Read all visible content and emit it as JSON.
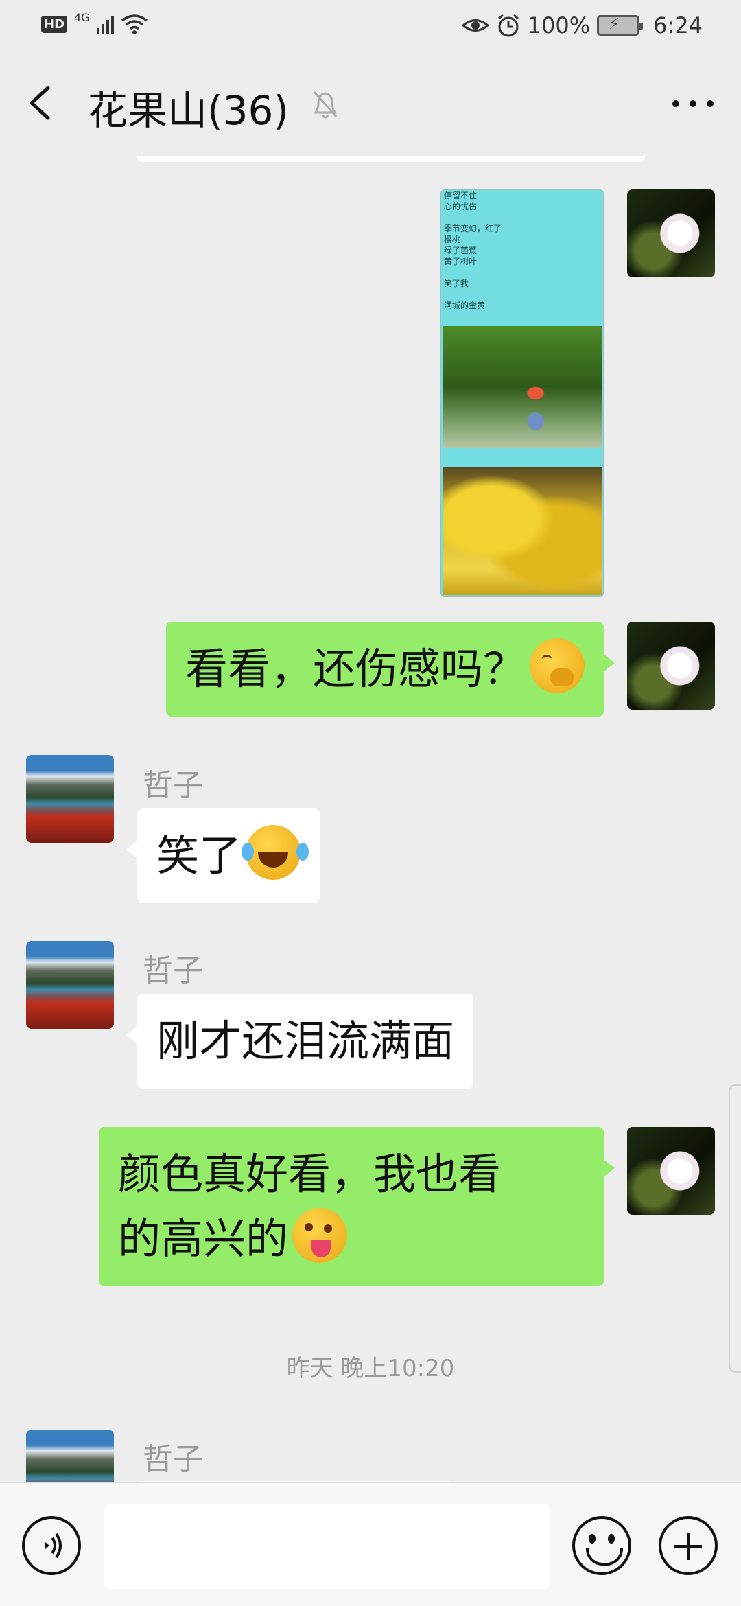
{
  "status_bar": {
    "hd": "HD",
    "network": "4G",
    "battery": "100%",
    "time": "6:24",
    "icons": [
      "hd-badge",
      "signal-icon",
      "wifi-icon",
      "eye-icon",
      "alarm-icon",
      "battery-icon"
    ]
  },
  "header": {
    "title": "花果山(36)",
    "icons": [
      "back-icon",
      "mute-icon",
      "more-icon"
    ]
  },
  "image_poem_lines": [
    "停留不住",
    "心的忧伤",
    "",
    "季节变幻，红了",
    "樱桃",
    "绿了芭蕉",
    "黄了树叶",
    "",
    "笑了我",
    "",
    "满城的金黄"
  ],
  "messages": [
    {
      "from": "me",
      "text": "看看，还伤感吗？",
      "emoji": "thinking-face-emoji"
    },
    {
      "from": "other",
      "sender": "哲子",
      "text": "笑了",
      "emoji": "tears-of-joy-emoji"
    },
    {
      "from": "other",
      "sender": "哲子",
      "text": "刚才还泪流满面"
    },
    {
      "from": "me",
      "text_line1": "颜色真好看，我也看",
      "text_line2": "的高兴的",
      "emoji": "winking-tongue-emoji"
    }
  ],
  "time_divider": "昨天 晚上10:20",
  "last_sender": "哲子",
  "input": {
    "value": ""
  }
}
